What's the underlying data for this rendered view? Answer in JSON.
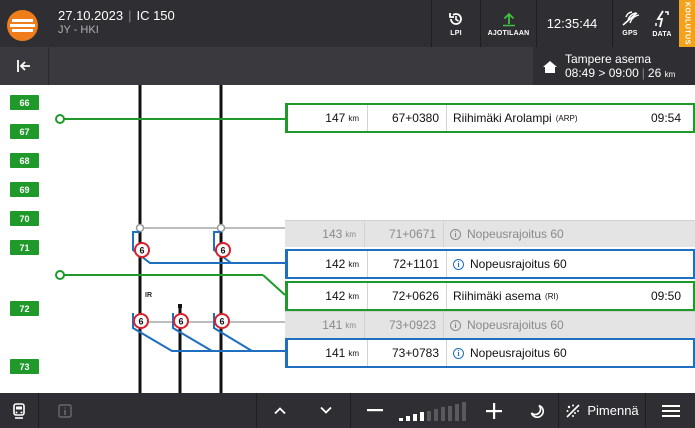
{
  "header": {
    "date": "27.10.2023",
    "train": "IC 150",
    "route": "JY - HKI",
    "lpi_label": "LPI",
    "ajotilaan_label": "AJOTILAAN",
    "clock": "12:35:44",
    "gps_label": "GPS",
    "data_label": "DATA",
    "test_tag": "KOULUTUS"
  },
  "destination": {
    "name": "Tampere asema",
    "arrival": "08:49",
    "arrow": ">",
    "departure": "09:00",
    "distance": "26",
    "distance_unit": "km"
  },
  "km_markers": [
    "66",
    "67",
    "68",
    "69",
    "70",
    "71",
    "72",
    "73"
  ],
  "rows": [
    {
      "type": "station",
      "dist": "147",
      "unit": "km",
      "km": "67+0380",
      "name": "Riihimäki Arolampi",
      "code": "(ARP)",
      "time": "09:54"
    },
    {
      "type": "passed",
      "dist": "143",
      "unit": "km",
      "km": "71+0671",
      "name": "Nopeusrajoitus 60"
    },
    {
      "type": "speed",
      "dist": "142",
      "unit": "km",
      "km": "72+1101",
      "name": "Nopeusrajoitus 60"
    },
    {
      "type": "station",
      "dist": "142",
      "unit": "km",
      "km": "72+0626",
      "name": "Riihimäki asema",
      "code": "(RI)",
      "time": "09:50"
    },
    {
      "type": "passed",
      "dist": "141",
      "unit": "km",
      "km": "73+0923",
      "name": "Nopeusrajoitus 60"
    },
    {
      "type": "speed",
      "dist": "141",
      "unit": "km",
      "km": "73+0783",
      "name": "Nopeusrajoitus 60"
    }
  ],
  "track": {
    "speed_sign_value": "6",
    "ir_label": "IR"
  },
  "footer": {
    "dim_label": "Pimennä",
    "brightness_level": 0.4
  },
  "colors": {
    "station_green": "#1f9a2a",
    "speed_blue": "#1f6fc1",
    "logo_orange": "#f07d1b",
    "test_yellow": "#f3a21c"
  },
  "icons": [
    "train-logo-icon",
    "history-icon",
    "upload-icon",
    "gps-icon",
    "data-icon",
    "collapse-left-icon",
    "home-icon",
    "info-icon",
    "speed-limit-sign-icon",
    "train-icon",
    "info-square-icon",
    "chevron-up-icon",
    "chevron-down-icon",
    "minus-icon",
    "plus-icon",
    "moon-icon",
    "dim-icon",
    "menu-icon"
  ]
}
